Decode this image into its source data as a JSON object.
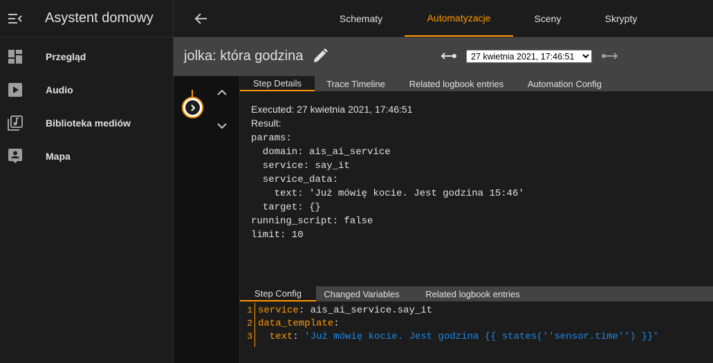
{
  "sidebar": {
    "title": "Asystent domowy",
    "items": [
      {
        "label": "Przegląd",
        "icon": "dashboard-icon"
      },
      {
        "label": "Audio",
        "icon": "play-icon"
      },
      {
        "label": "Biblioteka mediów",
        "icon": "media-library-icon"
      },
      {
        "label": "Mapa",
        "icon": "map-person-icon"
      }
    ]
  },
  "topbar": {
    "tabs": [
      {
        "label": "Schematy"
      },
      {
        "label": "Automatyzacje",
        "active": true
      },
      {
        "label": "Sceny"
      },
      {
        "label": "Skrypty"
      }
    ]
  },
  "header": {
    "title": "jolka: która godzina",
    "trace_selected": "27 kwietnia 2021, 17:46:51"
  },
  "detail_tabs": [
    {
      "label": "Step Details",
      "active": true
    },
    {
      "label": "Trace Timeline"
    },
    {
      "label": "Related logbook entries"
    },
    {
      "label": "Automation Config"
    }
  ],
  "details": {
    "executed": "Executed: 27 kwietnia 2021, 17:46:51",
    "result_label": "Result:",
    "yaml": "params:\n  domain: ais_ai_service\n  service: say_it\n  service_data:\n    text: 'Już mówię kocie. Jest godzina 15:46'\n  target: {}\nrunning_script: false\nlimit: 10"
  },
  "config_tabs": [
    {
      "label": "Step Config",
      "active": true
    },
    {
      "label": "Changed Variables"
    },
    {
      "label": "Related logbook entries"
    }
  ],
  "config": {
    "line_numbers": [
      "1",
      "2",
      "3"
    ],
    "line1_key": "service",
    "line1_value": " ais_ai_service.say_it",
    "line2_key": "data_template",
    "line3_key": "  text",
    "line3_value": " 'Już mówię kocie. Jest godzina {{ states(''sensor.time'') }}'"
  },
  "colors": {
    "accent": "#ff9800",
    "background": "#111111",
    "panel": "#1c1c1c",
    "header": "#434343",
    "string": "#1e88e5"
  }
}
